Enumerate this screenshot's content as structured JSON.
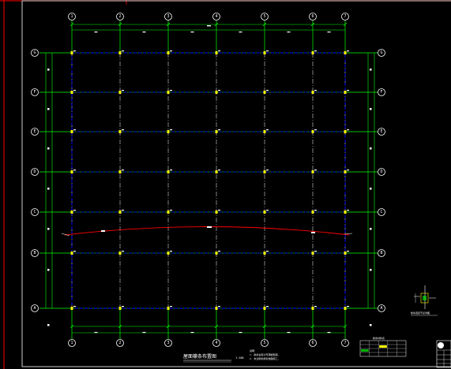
{
  "title": "屋面檩条布置图",
  "scale": "1:100",
  "axes_x": [
    "1",
    "2",
    "3",
    "4",
    "5",
    "6",
    "7"
  ],
  "axes_y": [
    "G",
    "F",
    "E",
    "D",
    "C",
    "B",
    "A"
  ],
  "colors": {
    "background": "#000000",
    "frame": "#ff0000",
    "grid": "#00ff00",
    "purlin": "#ffffff",
    "tie": "#0000ff",
    "curve": "#ff0000",
    "text": "#ffffff",
    "mark": "#ffff00"
  },
  "detail_title": "檩条连接节点详图",
  "table": {
    "title": "檩条材料表",
    "rows": 4,
    "cols": 5
  },
  "notes": [
    "说明：",
    "1. 檩条采用冷弯薄壁型钢。",
    "2. 未注明处按标准图施工。"
  ]
}
